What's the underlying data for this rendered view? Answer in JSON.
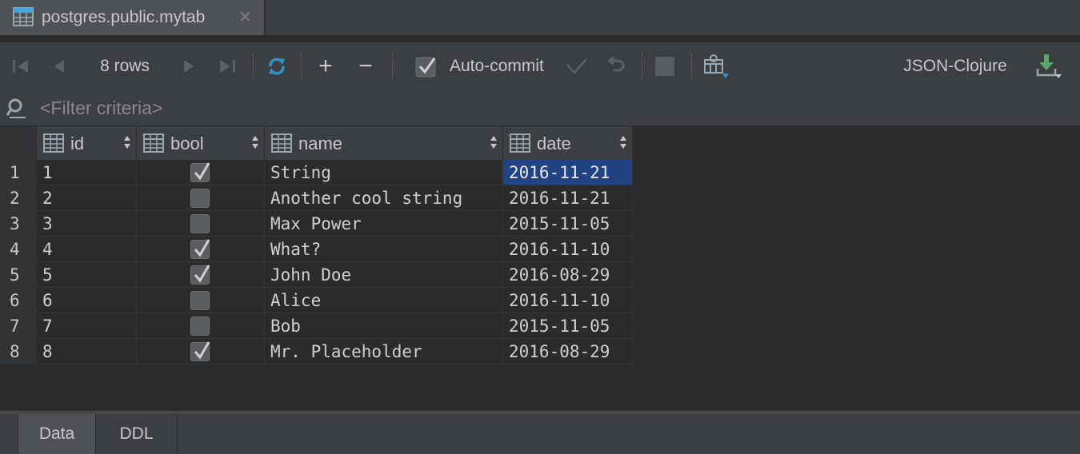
{
  "tab": {
    "title": "postgres.public.mytab",
    "close": "✕"
  },
  "toolbar": {
    "rows_label": "8 rows",
    "autocommit_label": "Auto-commit",
    "autocommit_checked": true,
    "add": "+",
    "remove": "−",
    "format_label": "JSON-Clojure"
  },
  "filter": {
    "placeholder": "<Filter criteria>"
  },
  "columns": [
    {
      "label": "id"
    },
    {
      "label": "bool"
    },
    {
      "label": "name"
    },
    {
      "label": "date"
    }
  ],
  "rows": [
    {
      "num": "1",
      "id": "1",
      "bool": true,
      "name": "String",
      "date": "2016-11-21"
    },
    {
      "num": "2",
      "id": "2",
      "bool": false,
      "name": "Another cool string",
      "date": "2016-11-21"
    },
    {
      "num": "3",
      "id": "3",
      "bool": false,
      "name": "Max Power",
      "date": "2015-11-05"
    },
    {
      "num": "4",
      "id": "4",
      "bool": true,
      "name": "What?",
      "date": "2016-11-10"
    },
    {
      "num": "5",
      "id": "5",
      "bool": true,
      "name": "John Doe",
      "date": "2016-08-29"
    },
    {
      "num": "6",
      "id": "6",
      "bool": false,
      "name": "Alice",
      "date": "2016-11-10"
    },
    {
      "num": "7",
      "id": "7",
      "bool": false,
      "name": "Bob",
      "date": "2015-11-05"
    },
    {
      "num": "8",
      "id": "8",
      "bool": true,
      "name": "Mr. Placeholder",
      "date": "2016-08-29"
    }
  ],
  "selected_cell": {
    "row": 0,
    "column": "date"
  },
  "bottom_tabs": [
    {
      "label": "Data",
      "active": true
    },
    {
      "label": "DDL",
      "active": false
    }
  ],
  "colors": {
    "background": "#2b2b2b",
    "panel": "#3c3f41",
    "selection": "#214283",
    "refresh_icon": "#3592c4",
    "download_icon": "#59a869"
  }
}
